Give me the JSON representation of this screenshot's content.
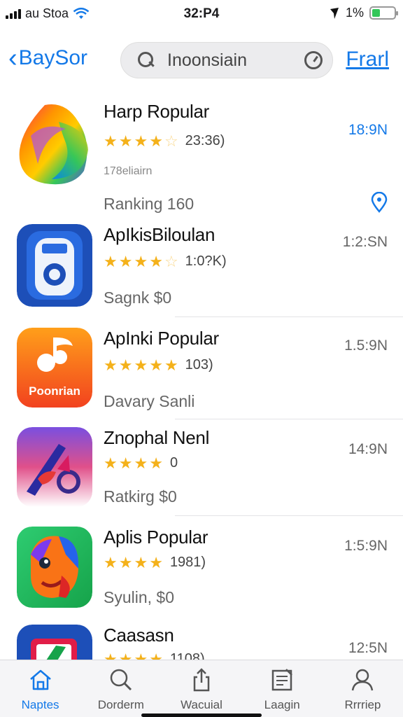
{
  "status_bar": {
    "carrier": "au Stoa",
    "time": "32:P4",
    "battery_text": "1%",
    "battery_level": 0.35,
    "battery_color": "#34c759"
  },
  "nav": {
    "back_label": "BaySor",
    "search_value": "Inoonsiain",
    "search_icon": "search-icon",
    "right_label": "Frarl",
    "accent": "#1479e8"
  },
  "apps": [
    {
      "name": "Harp Ropular",
      "rating": 4,
      "half": true,
      "count": "23:36)",
      "sub": "178eliairn",
      "info": "Ranking 160",
      "time": "18:9N",
      "time_blue": true,
      "extra": "location-pin-icon"
    },
    {
      "name": "ApIkisBiloulan",
      "rating": 4,
      "half": true,
      "count": "1:0?K)",
      "sub": "",
      "info": "Sagnk $0",
      "time": "1:2:SN"
    },
    {
      "name": "ApInki Popular",
      "rating": 5,
      "half": false,
      "count": "103)",
      "sub": "",
      "info": "Davary Sanli",
      "time": "1.5:9N",
      "icon_text": "Poonrian"
    },
    {
      "name": "Znophal Nenl",
      "rating": 4,
      "half": false,
      "count": "0",
      "sub": "",
      "info": "Ratkirg $0",
      "time": "14:9N"
    },
    {
      "name": "Aplis Popular",
      "rating": 4,
      "half": false,
      "count": "1981)",
      "sub": "",
      "info": "Syulin, $0",
      "time": "1:5:9N"
    },
    {
      "name": "Caasasn",
      "rating": 4,
      "half": false,
      "count": "1108)",
      "sub": "",
      "info": "",
      "time": "12:5N"
    }
  ],
  "tabs": [
    {
      "label": "Naptes",
      "icon": "home-icon",
      "active": true
    },
    {
      "label": "Dorderm",
      "icon": "search-icon",
      "active": false
    },
    {
      "label": "Wacuial",
      "icon": "share-icon",
      "active": false
    },
    {
      "label": "Laagin",
      "icon": "document-icon",
      "active": false
    },
    {
      "label": "Rrrriep",
      "icon": "person-icon",
      "active": false
    }
  ]
}
